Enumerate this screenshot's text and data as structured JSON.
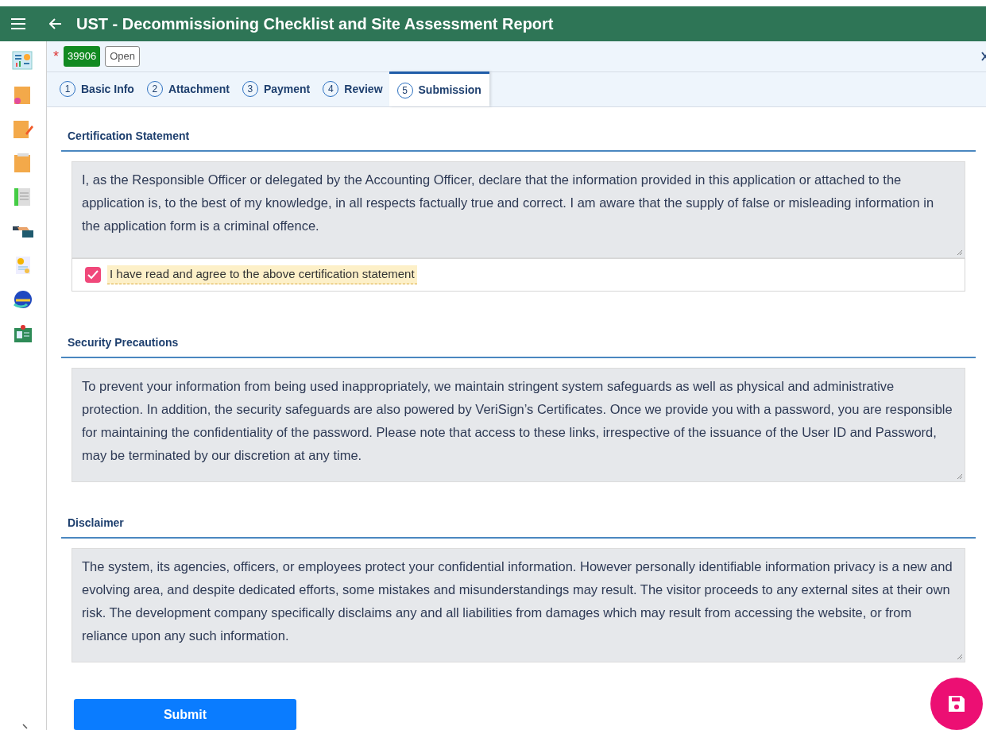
{
  "header": {
    "title": "UST - Decommissioning Checklist and Site Assessment Report"
  },
  "record": {
    "required_mark": "*",
    "number": "39906",
    "status": "Open"
  },
  "tabs": [
    {
      "number": "1",
      "label": "Basic Info",
      "selected": false
    },
    {
      "number": "2",
      "label": "Attachment",
      "selected": false
    },
    {
      "number": "3",
      "label": "Payment",
      "selected": false
    },
    {
      "number": "4",
      "label": "Review",
      "selected": false
    },
    {
      "number": "5",
      "label": "Submission",
      "selected": true
    }
  ],
  "sections": [
    {
      "title": "Certification Statement",
      "text": "I, as the Responsible Officer or delegated by the Accounting Officer, declare that the information provided in this application or attached to the application is, to the best of my knowledge, in all respects factually true and correct. I am aware that the supply of false or misleading information in the application form is a criminal offence.",
      "agreement": {
        "label": "I have read and agree to the above certification statement",
        "checked": true
      }
    },
    {
      "title": "Security Precautions",
      "text": "To prevent your information from being used inappropriately, we maintain stringent system safeguards as well as physical and administrative protection. In addition, the security safeguards are also powered by VeriSign’s Certificates. Once we provide you with a password, you are responsible for maintaining the confidentiality of the password. Please note that access to these links, irrespective of the issuance of the User ID and Password, may be terminated by our discretion at any time."
    },
    {
      "title": "Disclaimer",
      "text": "The system, its agencies, officers, or employees protect your confidential information. However personally identifiable information privacy is a new and evolving area, and despite dedicated efforts, some mistakes and misunderstandings may result. The visitor proceeds to any external sites at their own risk. The development company specifically disclaims any and all liabilities from damages which may result from accessing the website, or from reliance upon any such information."
    }
  ],
  "submit_button": "Submit"
}
